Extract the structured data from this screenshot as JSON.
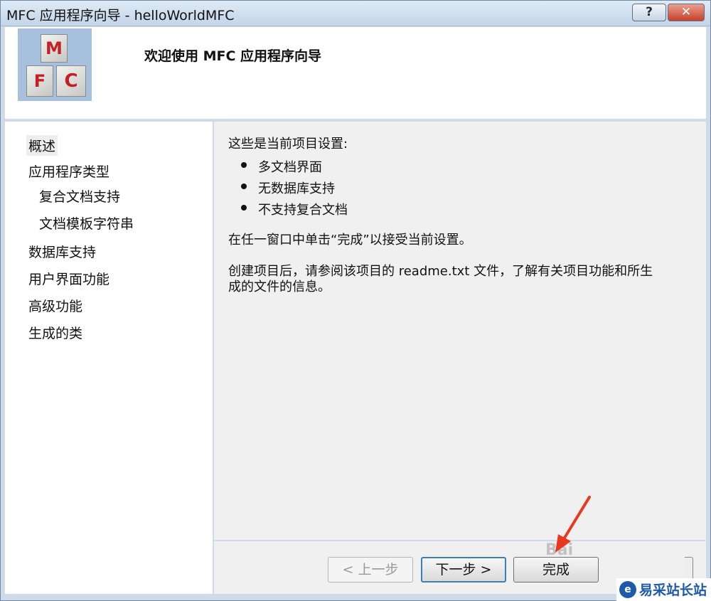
{
  "window": {
    "title": "MFC 应用程序向导 - helloWorldMFC",
    "help_label": "?",
    "close_label": "✕"
  },
  "header": {
    "logo_letters": [
      "M",
      "F",
      "C"
    ],
    "title": "欢迎使用 MFC 应用程序向导"
  },
  "nav": {
    "items": [
      {
        "label": "概述",
        "selected": true
      },
      {
        "label": "应用程序类型"
      },
      {
        "label": "复合文档支持"
      },
      {
        "label": "文档模板字符串"
      },
      {
        "label": "数据库支持"
      },
      {
        "label": "用户界面功能"
      },
      {
        "label": "高级功能"
      },
      {
        "label": "生成的类"
      }
    ]
  },
  "content": {
    "intro": "这些是当前项目设置:",
    "settings": [
      "多文档界面",
      "无数据库支持",
      "不支持复合文档"
    ],
    "instruction": "在任一窗口中单击“完成”以接受当前设置。",
    "note_line1": "创建项目后，请参阅该项目的 readme.txt 文件，了解有关项目功能和所生",
    "note_line2": "成的文件的信息。"
  },
  "buttons": {
    "back": "< 上一步",
    "next": "下一步 >",
    "finish": "完成"
  },
  "overlay": {
    "watermark": "Bai",
    "badge_text": "易采站长站",
    "annotation_color": "#e8381e"
  },
  "colors": {
    "window_frame": "#cfdbe8",
    "panel_bg": "#f0f0f0",
    "logo_bg": "#a7c0de",
    "logo_letters": "#c41f25",
    "default_button_border": "#3c7fb1"
  }
}
